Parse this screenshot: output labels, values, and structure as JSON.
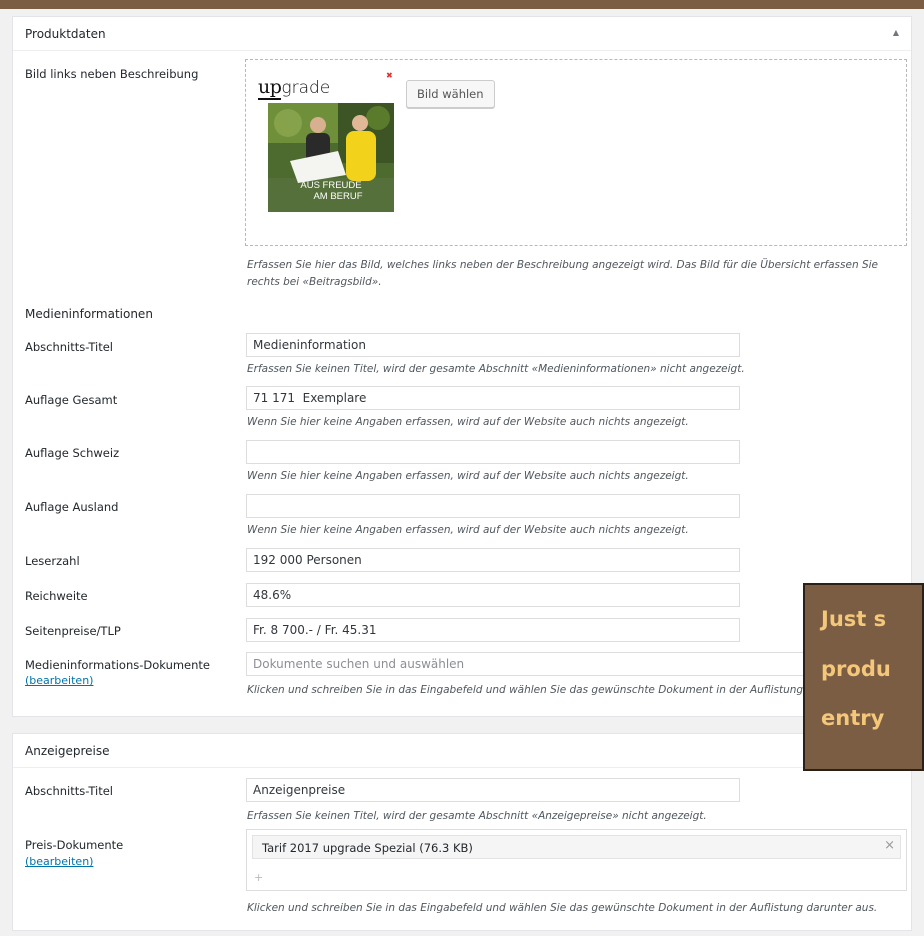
{
  "product_panel": {
    "title": "Produktdaten",
    "toggle_icon": "triangle-up",
    "image_field": {
      "label": "Bild links neben Beschreibung",
      "logo_text_1": "up",
      "logo_text_2": "grade",
      "cover_text_1": "AUS FREUDE",
      "cover_text_2": "AM BERUF",
      "choose_button": "Bild wählen",
      "help_line_1": "Erfassen Sie hier das Bild, welches links neben der Beschreibung angezeigt wird. Das Bild für die Übersicht erfassen Sie",
      "help_line_2": "rechts bei «Beitragsbild»."
    },
    "section_title": "Medieninformationen",
    "fields": {
      "abschnitts_titel": {
        "label": "Abschnitts-Titel",
        "value": "Medieninformation",
        "help": "Erfassen Sie keinen Titel, wird der gesamte Abschnitt «Medieninformationen» nicht angezeigt."
      },
      "auflage_gesamt": {
        "label": "Auflage Gesamt",
        "value": "71 171  Exemplare",
        "help": "Wenn Sie hier keine Angaben erfassen, wird auf der Website auch nichts angezeigt."
      },
      "auflage_schweiz": {
        "label": "Auflage Schweiz",
        "value": "",
        "help": "Wenn Sie hier keine Angaben erfassen, wird auf der Website auch nichts angezeigt."
      },
      "auflage_ausland": {
        "label": "Auflage Ausland",
        "value": "",
        "help": "Wenn Sie hier keine Angaben erfassen, wird auf der Website auch nichts angezeigt."
      },
      "leserzahl": {
        "label": "Leserzahl",
        "value": "192 000 Personen"
      },
      "reichweite": {
        "label": "Reichweite",
        "value": "48.6%"
      },
      "seitenpreise": {
        "label": "Seitenpreise/TLP",
        "value": "Fr. 8 700.- / Fr. 45.31"
      },
      "medien_dokumente": {
        "label": "Medieninformations-Dokumente",
        "edit_link": "(bearbeiten)",
        "placeholder": "Dokumente suchen und auswählen",
        "help": "Klicken und schreiben Sie in das Eingabefeld und wählen Sie das gewünschte Dokument in der Auflistung darunter aus."
      }
    }
  },
  "ads_panel": {
    "title": "Anzeigepreise",
    "abschnitts_titel": {
      "label": "Abschnitts-Titel",
      "value": "Anzeigenpreise",
      "help": "Erfassen Sie keinen Titel, wird der gesamte Abschnitt «Anzeigepreise» nicht angezeigt."
    },
    "preis_dokumente": {
      "label": "Preis-Dokumente",
      "edit_link": "(bearbeiten)",
      "document": "Tarif 2017 upgrade Spezial (76.3 KB)",
      "remove_icon": "×",
      "add_icon": "+",
      "help": "Klicken und schreiben Sie in das Eingabefeld und wählen Sie das gewünschte Dokument in der Auflistung darunter aus."
    }
  },
  "overlay": {
    "line1": "Just s",
    "line2": "produ",
    "line3": "entry"
  },
  "colors": {
    "accent": "#7a5d43",
    "overlay_text": "#f4c77a",
    "link": "#0073aa"
  }
}
